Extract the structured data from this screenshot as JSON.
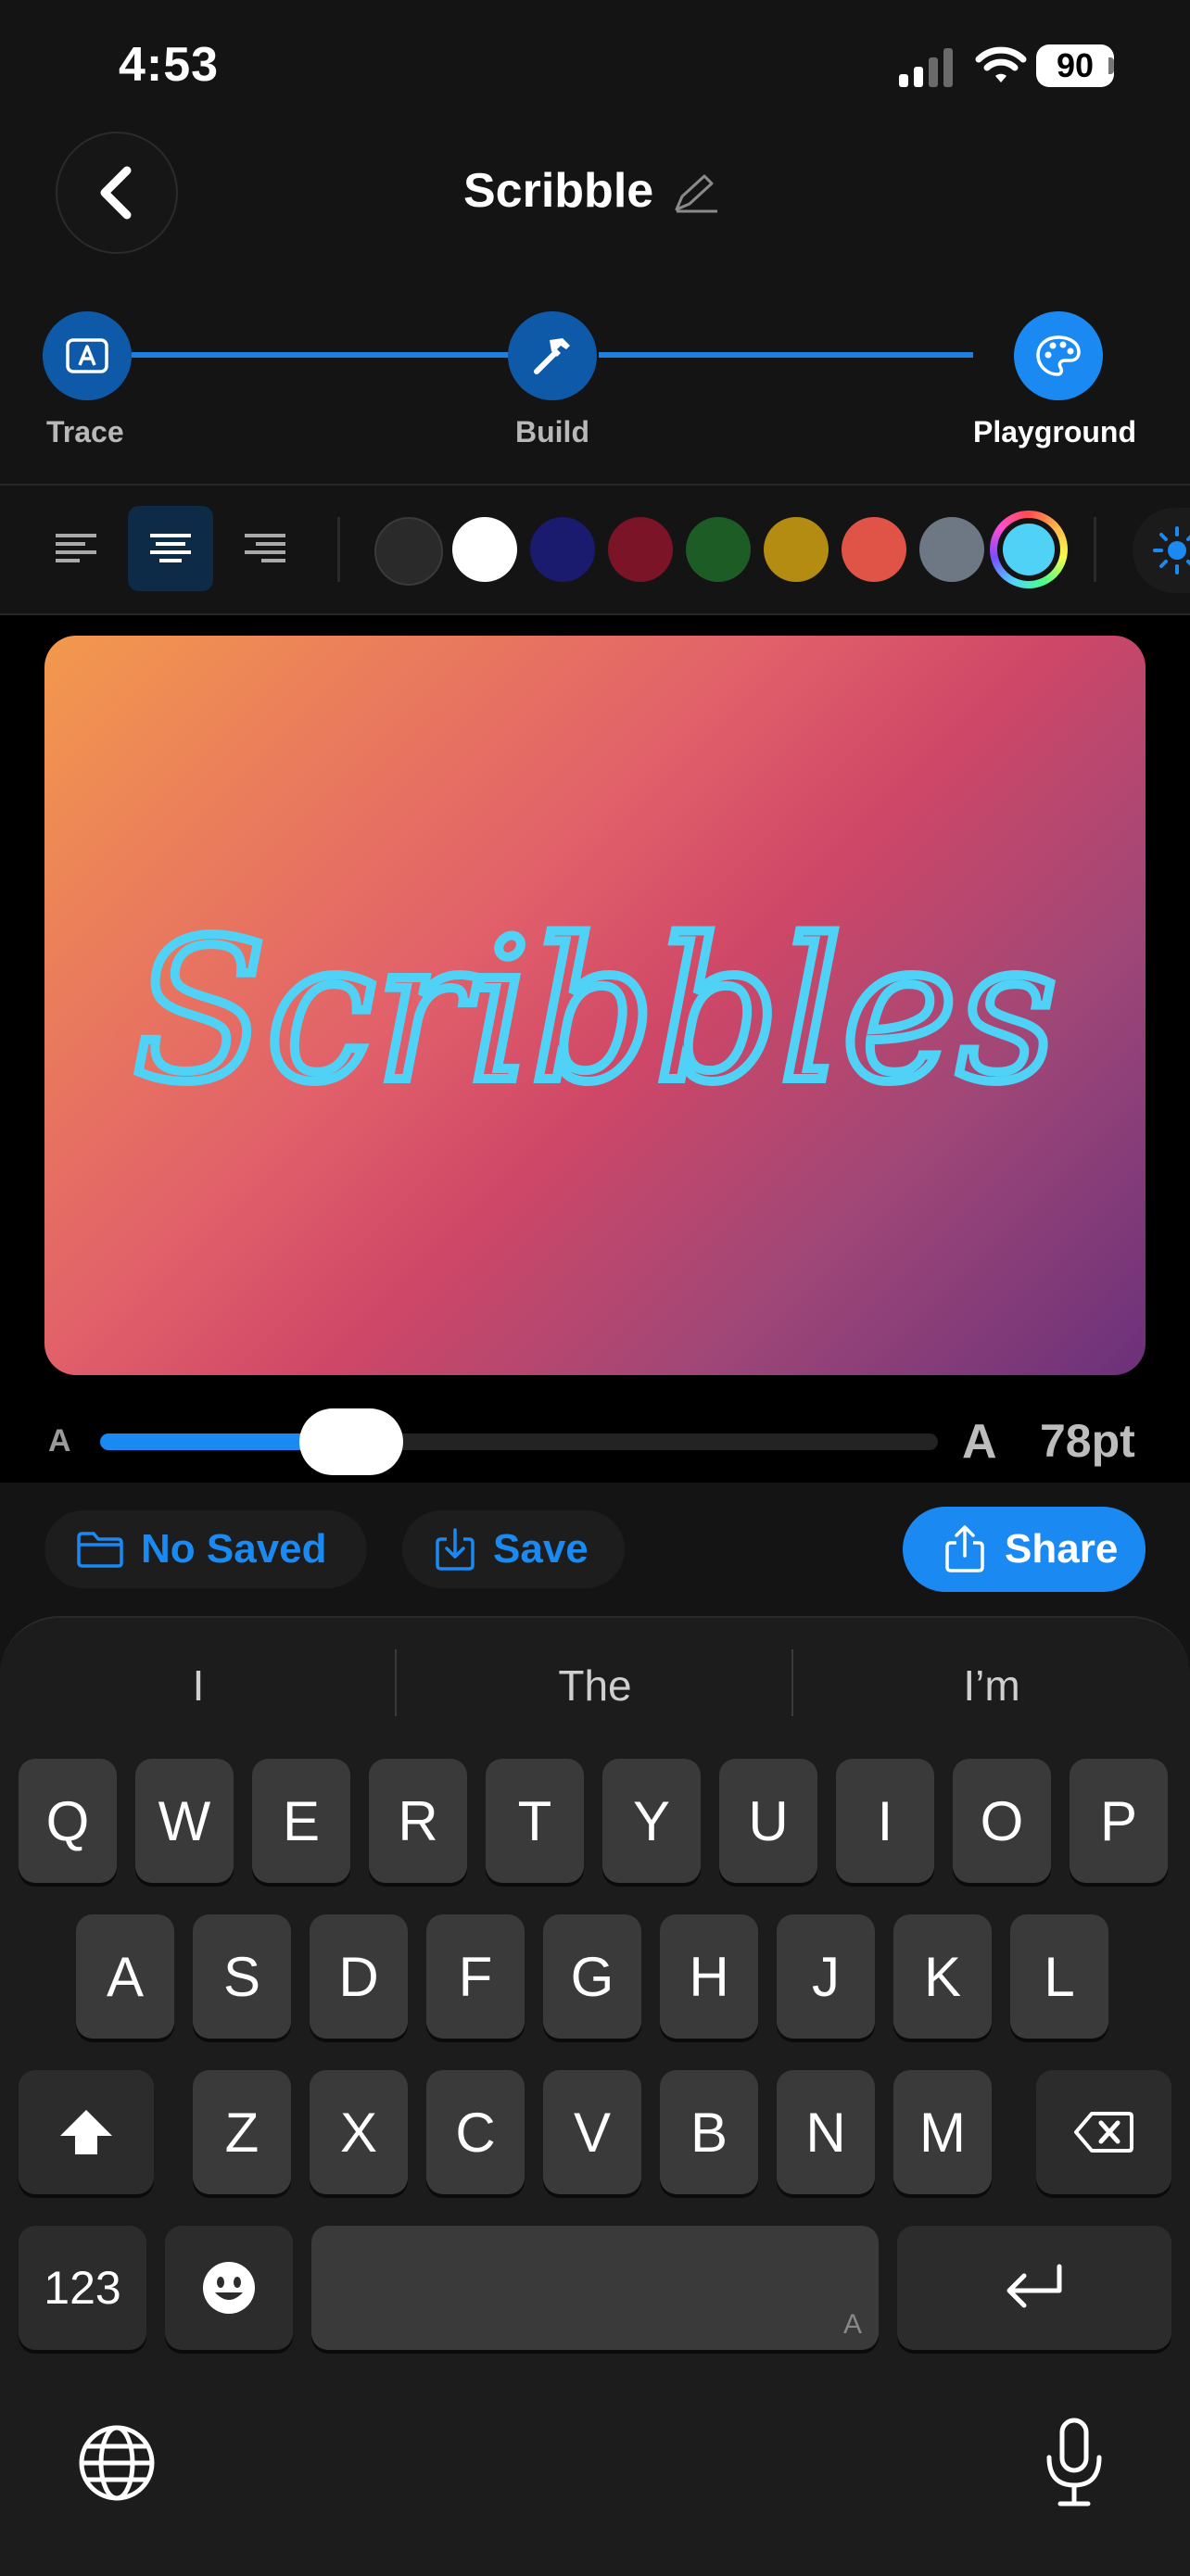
{
  "status": {
    "time": "4:53",
    "battery": "90"
  },
  "header": {
    "title": "Scribble"
  },
  "steps": [
    {
      "label": "Trace"
    },
    {
      "label": "Build"
    },
    {
      "label": "Playground"
    }
  ],
  "swatches": [
    "#2a2a2a",
    "#ffffff",
    "#1a1a6e",
    "#7a1426",
    "#1e5c26",
    "#b48c12",
    "#e05448",
    "#6e7885"
  ],
  "selected_color": "#4fd2f5",
  "canvas": {
    "text": "Scribbles",
    "text_color": "#4fd2f5"
  },
  "size": {
    "small_glyph": "A",
    "large_glyph": "A",
    "value": "78pt",
    "level": 0.3
  },
  "actions": {
    "saved": "No Saved",
    "save": "Save",
    "share": "Share"
  },
  "keyboard": {
    "suggestions": [
      "I",
      "The",
      "I’m"
    ],
    "row1": [
      "Q",
      "W",
      "E",
      "R",
      "T",
      "Y",
      "U",
      "I",
      "O",
      "P"
    ],
    "row2": [
      "A",
      "S",
      "D",
      "F",
      "G",
      "H",
      "J",
      "K",
      "L"
    ],
    "row3": [
      "Z",
      "X",
      "C",
      "V",
      "B",
      "N",
      "M"
    ],
    "numbers_key": "123",
    "space_mark": "A"
  }
}
